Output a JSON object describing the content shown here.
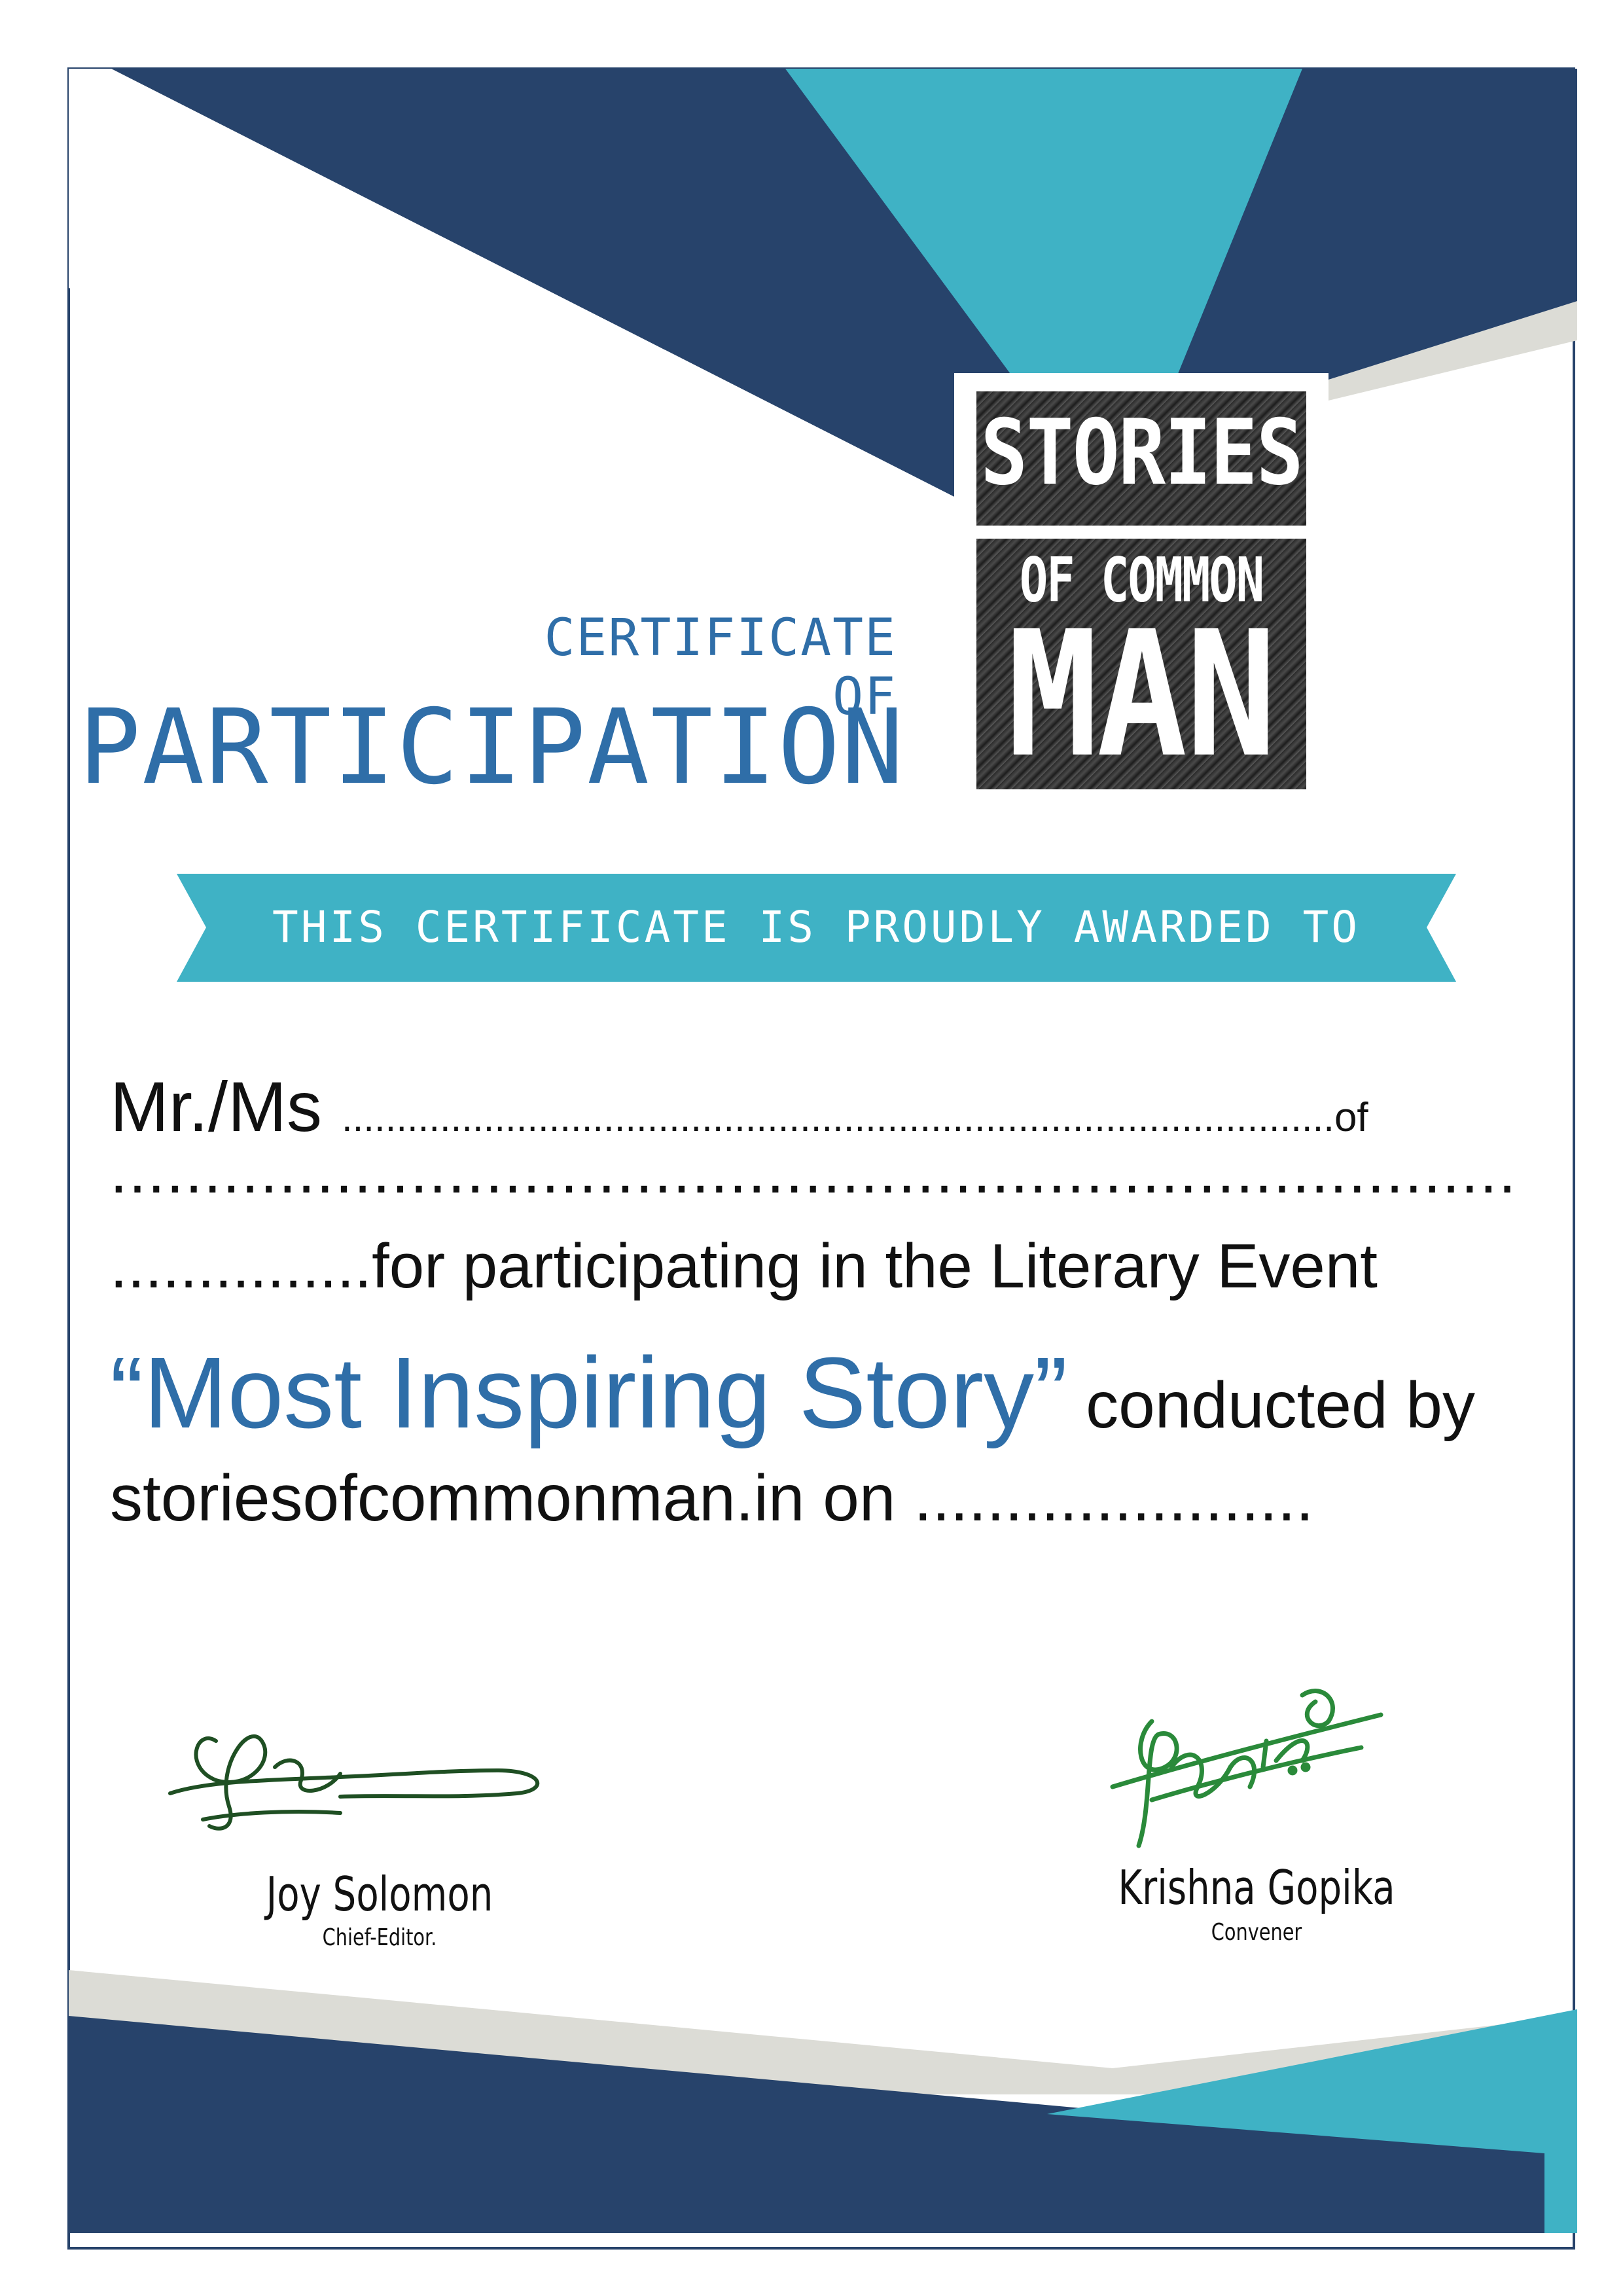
{
  "header": {
    "subtitle": "CERTIFICATE OF",
    "title": "PARTICIPATION"
  },
  "logo": {
    "line1": "STORIES",
    "line2": "OF COMMON",
    "line3": "MAN"
  },
  "ribbon": {
    "text": "THIS CERTIFICATE IS PROUDLY AWARDED TO"
  },
  "body": {
    "salutation": "Mr./Ms",
    "name_blank": "...........................................................................................",
    "of_word": "of",
    "organization_blank": "...........................................................................",
    "lead_blank": "...............",
    "participation_text": "for participating in the Literary Event",
    "event_name": "“Most Inspiring Story”",
    "conducted_text": " conducted by",
    "website_text": "storiesofcommonman.in on ",
    "date_blank": "......................"
  },
  "signatories": [
    {
      "name": "Joy Solomon",
      "role": "Chief-Editor."
    },
    {
      "name": "Krishna Gopika",
      "role": "Convener"
    }
  ],
  "colors": {
    "navy": "#27436b",
    "teal": "#3fb2c5",
    "light_gray": "#dcdcd6",
    "title_blue": "#2f6ea8",
    "signature_1": "#1f4f23",
    "signature_2": "#2a8a3a"
  }
}
